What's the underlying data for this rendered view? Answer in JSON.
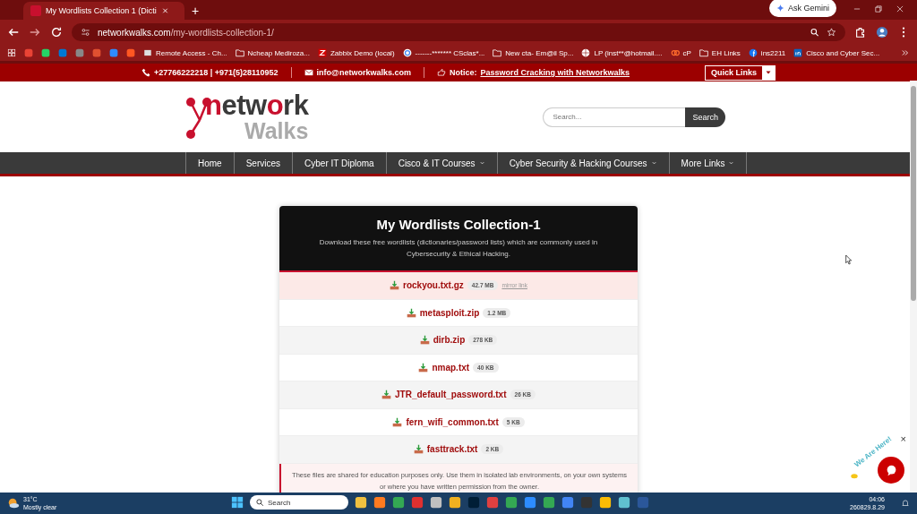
{
  "browser": {
    "tab_title": "My Wordlists Collection 1 (Dicti",
    "new_tab": "+",
    "ask_gemini": "Ask Gemini",
    "url_host": "networkwalks.com",
    "url_path": "/my-wordlists-collection-1/",
    "bookmarks": [
      {
        "kind": "page",
        "label": "Remote Access - Ch..."
      },
      {
        "kind": "folder",
        "label": "Ncheap Mediroza..."
      },
      {
        "kind": "zabbix",
        "label": "Zabbix Demo (local)"
      },
      {
        "kind": "google",
        "label": "-------******* CSclas*..."
      },
      {
        "kind": "folder",
        "label": "New cta- Em@il Sp..."
      },
      {
        "kind": "globe",
        "label": "LP (inst**@hotmail...."
      },
      {
        "kind": "cpanel",
        "label": "cP"
      },
      {
        "kind": "folder",
        "label": "EH Links"
      },
      {
        "kind": "facebook",
        "label": "ins2211"
      },
      {
        "kind": "linkedin",
        "label": "Cisco and Cyber Sec..."
      }
    ]
  },
  "site": {
    "topbar": {
      "phone": "+27766222218 | +971(5)28110952",
      "email": "info@networkwalks.com",
      "notice_label": "Notice:",
      "notice_link": "Password Cracking with Networkwalks",
      "quick_links": "Quick Links"
    },
    "logo": {
      "parts": [
        {
          "text": "n",
          "color": "#c8102e"
        },
        {
          "text": "etw",
          "color": "#3a3a3a"
        },
        {
          "text": "o",
          "color": "#c8102e"
        },
        {
          "text": "rk",
          "color": "#3a3a3a"
        }
      ],
      "line2": "Walks"
    },
    "search": {
      "placeholder": "Search...",
      "button": "Search"
    },
    "nav": [
      {
        "label": "Home",
        "dropdown": false
      },
      {
        "label": "Services",
        "dropdown": false
      },
      {
        "label": "Cyber IT Diploma",
        "dropdown": false
      },
      {
        "label": "Cisco & IT Courses",
        "dropdown": true
      },
      {
        "label": "Cyber Security & Hacking Courses",
        "dropdown": true
      },
      {
        "label": "More Links",
        "dropdown": true
      }
    ]
  },
  "card": {
    "title": "My Wordlists Collection-1",
    "subtitle": "Download these free wordlists (dictionaries/password lists) which are commonly used in Cybersecurity & Ethical Hacking.",
    "files": [
      {
        "name": "rockyou.txt.gz",
        "size": "42.7 MB",
        "mirror": "mirror link",
        "highlighted": true
      },
      {
        "name": "metasploit.zip",
        "size": "1.2 MB",
        "highlighted": false
      },
      {
        "name": "dirb.zip",
        "size": "278 KB",
        "highlighted": false
      },
      {
        "name": "nmap.txt",
        "size": "40 KB",
        "highlighted": false
      },
      {
        "name": "JTR_default_password.txt",
        "size": "26 KB",
        "highlighted": false
      },
      {
        "name": "fern_wifi_common.txt",
        "size": "5 KB",
        "highlighted": false
      },
      {
        "name": "fasttrack.txt",
        "size": "2 KB",
        "highlighted": false
      }
    ],
    "note": "These files are shared for education purposes only. Use them in isolated lab environments, on your own systems or where you have written permission from the owner."
  },
  "chat_widget": {
    "text": "We Are Here!",
    "close": "×"
  },
  "taskbar": {
    "temperature": "31°C",
    "weather": "Mostly clear",
    "search_placeholder": "Search",
    "time": "04:06",
    "date": "260829.8.29"
  }
}
